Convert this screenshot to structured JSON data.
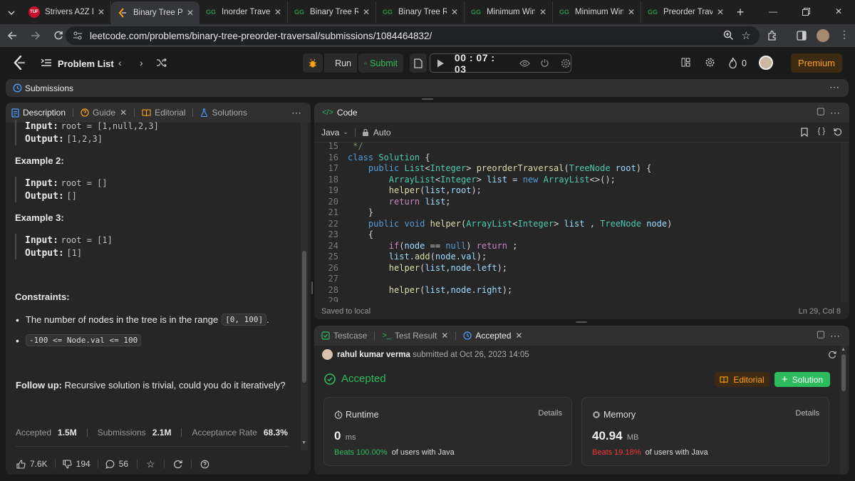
{
  "browser": {
    "tabs": [
      {
        "label": "Strivers A2Z DSA",
        "icon": "tuf-icon",
        "active": false
      },
      {
        "label": "Binary Tree Preorder",
        "icon": "leetcode-icon",
        "active": true
      },
      {
        "label": "Inorder Traversal",
        "icon": "gfg-icon",
        "active": false
      },
      {
        "label": "Binary Tree Representation",
        "icon": "gfg-icon",
        "active": false
      },
      {
        "label": "Binary Tree Representation",
        "icon": "gfg-icon",
        "active": false
      },
      {
        "label": "Minimum Window",
        "icon": "gfg-icon",
        "active": false
      },
      {
        "label": "Minimum Window",
        "icon": "gfg-icon",
        "active": false
      },
      {
        "label": "Preorder Traversal",
        "icon": "gfg-icon",
        "active": false
      }
    ],
    "tuf_badge": "TUF",
    "url": "leetcode.com/problems/binary-tree-preorder-traversal/submissions/1084464832/"
  },
  "header": {
    "problem_list": "Problem List",
    "run": "Run",
    "submit": "Submit",
    "timer": "00 : 07 : 03",
    "streak": "0",
    "premium": "Premium"
  },
  "submissions_bar": {
    "label": "Submissions"
  },
  "left_tabs": [
    "Description",
    "Guide",
    "Editorial",
    "Solutions"
  ],
  "description": {
    "ex1_input_label": "Input:",
    "ex1_input": "root = [1,null,2,3]",
    "ex1_output_label": "Output:",
    "ex1_output": "[1,2,3]",
    "ex2_title": "Example 2:",
    "ex2_input_label": "Input:",
    "ex2_input": "root = []",
    "ex2_output_label": "Output:",
    "ex2_output": "[]",
    "ex3_title": "Example 3:",
    "ex3_input_label": "Input:",
    "ex3_input": "root = [1]",
    "ex3_output_label": "Output:",
    "ex3_output": "[1]",
    "constraints_title": "Constraints:",
    "constraint1_text": "The number of nodes in the tree is in the range",
    "constraint1_code": "[0, 100]",
    "constraint1_tail": ".",
    "constraint2_code": "-100 <= Node.val <= 100",
    "followup_label": "Follow up:",
    "followup_text": "Recursive solution is trivial, could you do it iteratively?",
    "accepted_label": "Accepted",
    "accepted_value": "1.5M",
    "submissions_label": "Submissions",
    "submissions_value": "2.1M",
    "rate_label": "Acceptance Rate",
    "rate_value": "68.3%",
    "likes": "7.6K",
    "dislikes": "194",
    "comments": "56"
  },
  "code": {
    "title": "Code",
    "language": "Java",
    "mode": "Auto",
    "status": "Saved to local",
    "cursor": "Ln 29, Col 8",
    "line_numbers": [
      "15",
      "16",
      "17",
      "18",
      "19",
      "20",
      "21",
      "22",
      "23",
      "24",
      "25",
      "26",
      "27",
      "28",
      "29"
    ]
  },
  "result": {
    "tabs": [
      "Testcase",
      "Test Result",
      "Accepted"
    ],
    "user": "rahul kumar verma",
    "submitted_text": "submitted at Oct 26, 2023 14:05",
    "status": "Accepted",
    "editorial": "Editorial",
    "solution": "Solution",
    "runtime_label": "Runtime",
    "runtime_value": "0",
    "runtime_unit": "ms",
    "runtime_beats": "Beats 100.00%",
    "runtime_tail": "of users with Java",
    "memory_label": "Memory",
    "memory_value": "40.94",
    "memory_unit": "MB",
    "memory_beats": "Beats 19.18%",
    "memory_tail": "of users with Java",
    "details": "Details"
  },
  "colors": {
    "accent_green": "#2cbb5d",
    "premium_orange": "#ffa116",
    "memory_red": "#f63636"
  }
}
